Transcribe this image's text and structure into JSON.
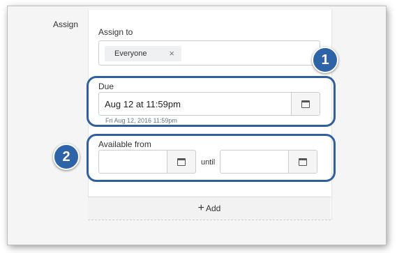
{
  "assign": {
    "section_label": "Assign",
    "assign_to_label": "Assign to",
    "chip_label": "Everyone",
    "chip_remove": "×"
  },
  "due": {
    "label": "Due",
    "value": "Aug 12 at 11:59pm",
    "hint": "Fri Aug 12, 2016 11:59pm"
  },
  "available": {
    "label": "Available from",
    "from_value": "",
    "until_label": "until",
    "until_value": ""
  },
  "add": {
    "icon": "+",
    "label": "Add"
  },
  "callouts": [
    "1",
    "2"
  ],
  "colors": {
    "callout_blue": "#2f63a8",
    "highlight_border": "#2f5fa0"
  }
}
